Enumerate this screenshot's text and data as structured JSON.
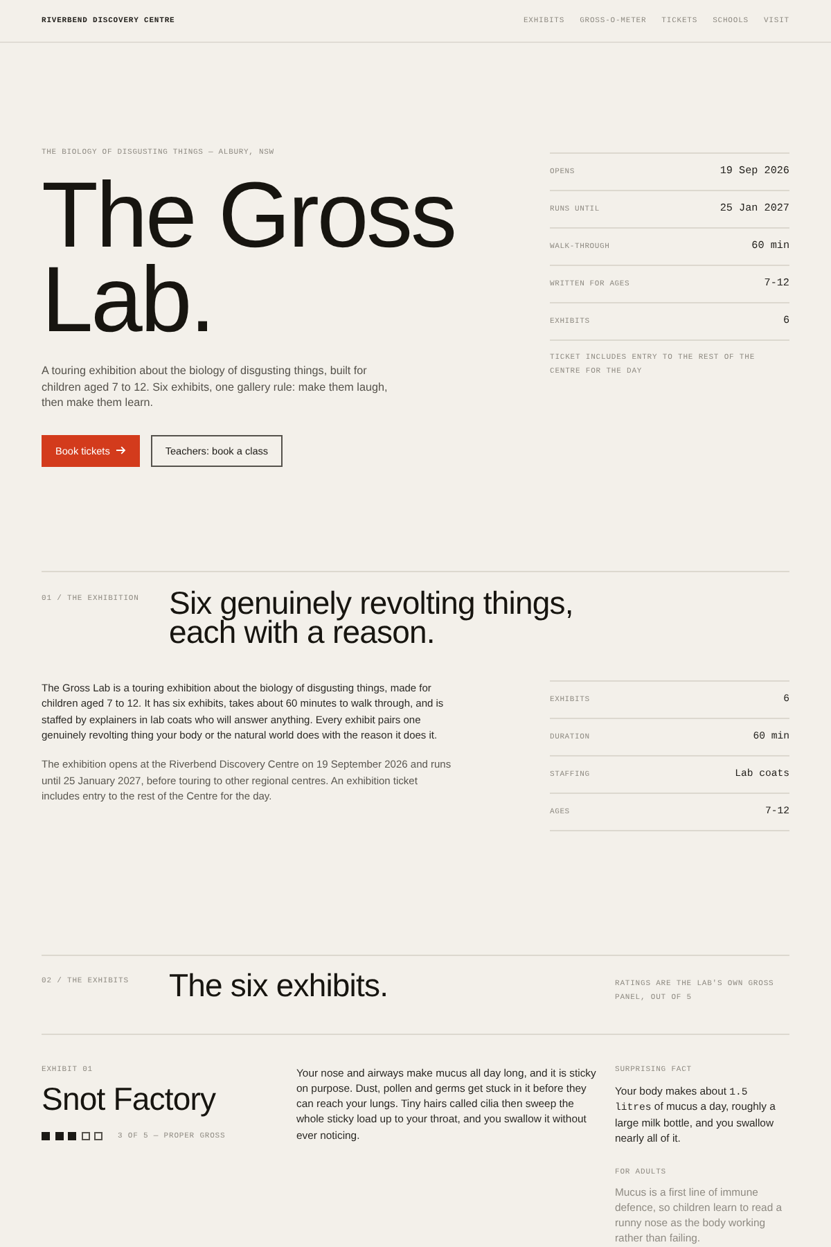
{
  "nav": {
    "brand": "RIVERBEND DISCOVERY CENTRE",
    "links": [
      {
        "label": "EXHIBITS"
      },
      {
        "label": "GROSS-O-METER"
      },
      {
        "label": "TICKETS"
      },
      {
        "label": "SCHOOLS"
      },
      {
        "label": "VISIT"
      }
    ]
  },
  "hero": {
    "eyebrow": "THE BIOLOGY OF DISGUSTING THINGS — ALBURY, NSW",
    "title": "The Gross Lab.",
    "intro": "A touring exhibition about the biology of disgusting things, built for children aged 7 to 12. Six exhibits, one gallery rule: make them laugh, then make them learn.",
    "buttons": [
      {
        "label": "Book tickets",
        "kind": "primary"
      },
      {
        "label": "Teachers: book a class",
        "kind": "outline"
      }
    ],
    "facts": [
      {
        "label": "OPENS",
        "value": "19 Sep 2026"
      },
      {
        "label": "RUNS UNTIL",
        "value": "25 Jan 2027"
      },
      {
        "label": "WALK-THROUGH",
        "value": "60 min"
      },
      {
        "label": "WRITTEN FOR AGES",
        "value": "7-12"
      },
      {
        "label": "EXHIBITS",
        "value": "6"
      }
    ],
    "note": "TICKET INCLUDES ENTRY TO THE REST OF THE CENTRE FOR THE DAY"
  },
  "exhibition": {
    "label": "01 / THE EXHIBITION",
    "heading": "Six genuinely revolting things, each with a reason.",
    "paragraphs": [
      {
        "kind": "lead",
        "text": "The Gross Lab is a touring exhibition about the biology of disgusting things, made for children aged 7 to 12. It has six exhibits, takes about 60 minutes to walk through, and is staffed by explainers in lab coats who will answer anything. Every exhibit pairs one genuinely revolting thing your body or the natural world does with the reason it does it."
      },
      {
        "kind": "muted",
        "text": "The exhibition opens at the Riverbend Discovery Centre on 19 September 2026 and runs until 25 January 2027, before touring to other regional centres. An exhibition ticket includes entry to the rest of the Centre for the day."
      }
    ],
    "facts": [
      {
        "label": "EXHIBITS",
        "value": "6"
      },
      {
        "label": "DURATION",
        "value": "60 min"
      },
      {
        "label": "STAFFING",
        "value": "Lab coats"
      },
      {
        "label": "AGES",
        "value": "7-12"
      }
    ]
  },
  "exhibits": {
    "label": "02 / THE EXHIBITS",
    "heading": "The six exhibits.",
    "note": "RATINGS ARE THE LAB'S OWN GROSS PANEL, OUT OF 5",
    "items": [
      {
        "number": "EXHIBIT 01",
        "title": "Snot Factory",
        "stars": 3,
        "rating_text": "3 OF 5 — PROPER GROSS",
        "description": "Your nose and airways make mucus all day long, and it is sticky on purpose. Dust, pollen and germs get stuck in it before they can reach your lungs. Tiny hairs called cilia then sweep the whole sticky load up to your throat, and you swallow it without ever noticing.",
        "fact_label": "SURPRISING FACT",
        "fact": [
          {
            "kind": "text",
            "text": "Your body makes about "
          },
          {
            "kind": "code",
            "text": "1.5 litres"
          },
          {
            "kind": "text",
            "text": " of mucus a day, roughly a large milk bottle, and you swallow nearly all of it."
          }
        ],
        "adults_label": "FOR ADULTS",
        "adults_text": "Mucus is a first line of immune defence, so children learn to read a runny nose as the body working rather than failing."
      }
    ]
  }
}
